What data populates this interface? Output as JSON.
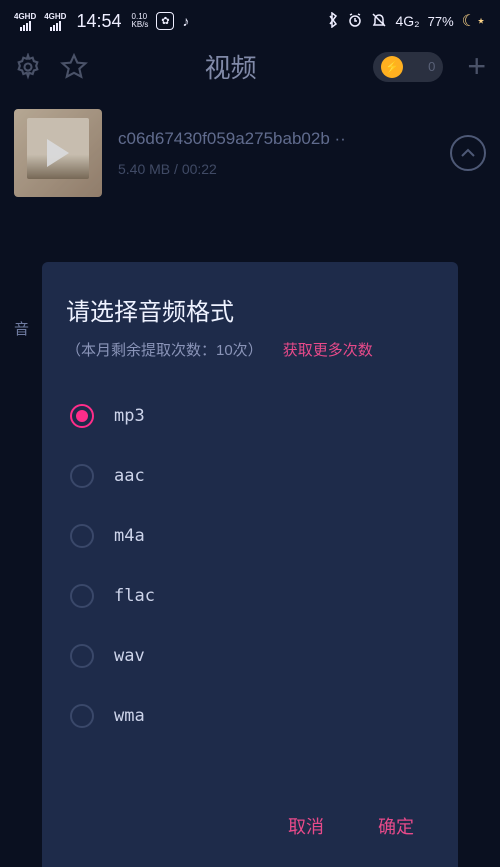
{
  "status": {
    "net1": "4GHD",
    "net2": "4GHD",
    "time": "14:54",
    "speed_top": "0.10",
    "speed_bot": "KB/s",
    "net_badge": "4G₂",
    "battery": "77%"
  },
  "header": {
    "title": "视频",
    "pill_count": "0"
  },
  "video": {
    "title": "c06d67430f059a275bab02b ··",
    "size": "5.40 MB",
    "sep": " / ",
    "duration": "00:22"
  },
  "partial_bg": "音",
  "dialog": {
    "title": "请选择音频格式",
    "sub_left": "（本月剩余提取次数：10次）",
    "sub_link": "获取更多次数",
    "cancel": "取消",
    "confirm": "确定",
    "options": {
      "0": "mp3",
      "1": "aac",
      "2": "m4a",
      "3": "flac",
      "4": "wav",
      "5": "wma"
    },
    "selected": 0
  },
  "colors": {
    "accent": "#ff2d8a",
    "link": "#e84a8a"
  }
}
